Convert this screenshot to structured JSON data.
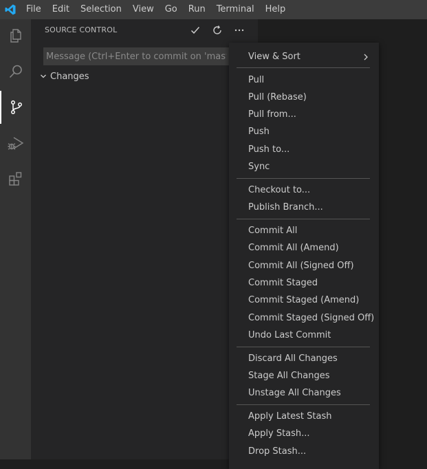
{
  "menubar": {
    "items": [
      "File",
      "Edit",
      "Selection",
      "View",
      "Go",
      "Run",
      "Terminal",
      "Help"
    ]
  },
  "activitybar": {
    "icons": [
      "files-icon",
      "search-icon",
      "source-control-icon",
      "run-debug-icon",
      "extensions-icon"
    ],
    "active": "source-control-icon"
  },
  "sidebar": {
    "title": "SOURCE CONTROL",
    "actions": [
      "check-icon",
      "refresh-icon",
      "more-icon"
    ],
    "commit_placeholder": "Message (Ctrl+Enter to commit on 'master')",
    "commit_value": "",
    "changes_label": "Changes"
  },
  "context_menu": {
    "view_sort": "View & Sort",
    "groups": [
      [
        "Pull",
        "Pull (Rebase)",
        "Pull from...",
        "Push",
        "Push to...",
        "Sync"
      ],
      [
        "Checkout to...",
        "Publish Branch..."
      ],
      [
        "Commit All",
        "Commit All (Amend)",
        "Commit All (Signed Off)",
        "Commit Staged",
        "Commit Staged (Amend)",
        "Commit Staged (Signed Off)",
        "Undo Last Commit"
      ],
      [
        "Discard All Changes",
        "Stage All Changes",
        "Unstage All Changes"
      ],
      [
        "Apply Latest Stash",
        "Apply Stash...",
        "Drop Stash..."
      ]
    ]
  },
  "colors": {
    "titlebar": "#3c3c3c",
    "activitybar": "#333333",
    "sidebar": "#252526",
    "editor": "#1e1e1e",
    "accent": "#007acc"
  }
}
